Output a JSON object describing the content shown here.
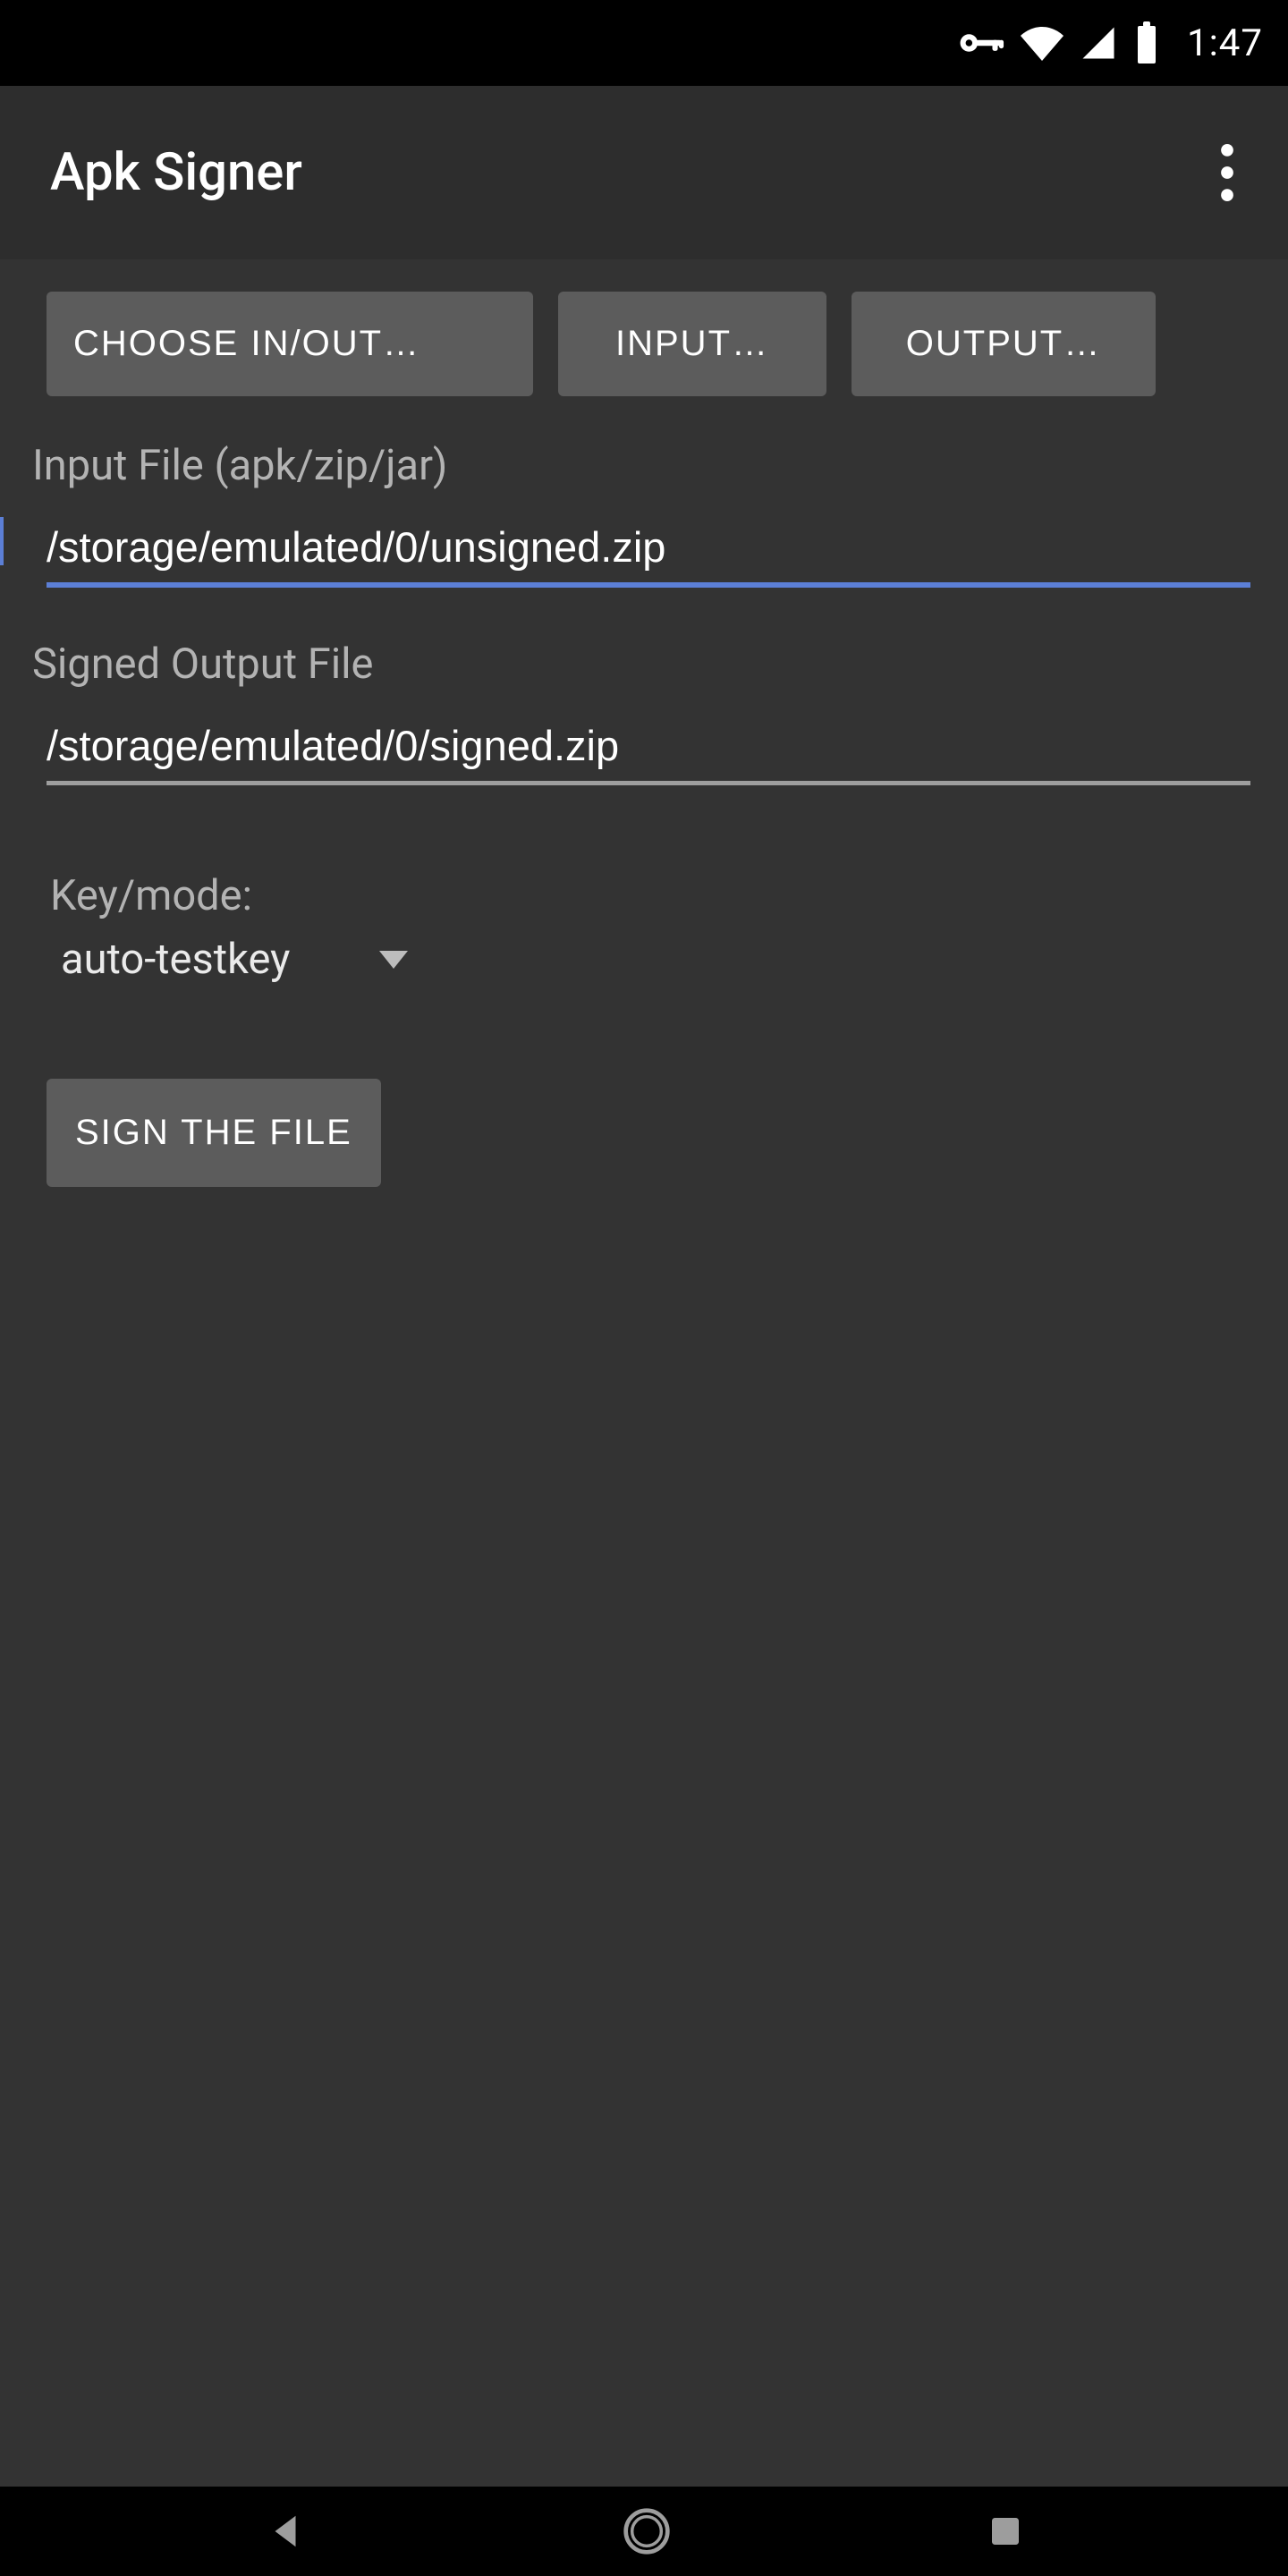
{
  "status": {
    "time": "1:47"
  },
  "actionbar": {
    "title": "Apk Signer"
  },
  "buttons": {
    "choose": "CHOOSE IN/OUT…",
    "input": "INPUT…",
    "output": "OUTPUT…",
    "sign": "SIGN THE FILE"
  },
  "labels": {
    "input_file": "Input File (apk/zip/jar)",
    "output_file": "Signed Output File",
    "keymode": "Key/mode:"
  },
  "fields": {
    "input_value": "/storage/emulated/0/unsigned.zip",
    "output_value": "/storage/emulated/0/signed.zip"
  },
  "keymode": {
    "selected": "auto-testkey"
  }
}
